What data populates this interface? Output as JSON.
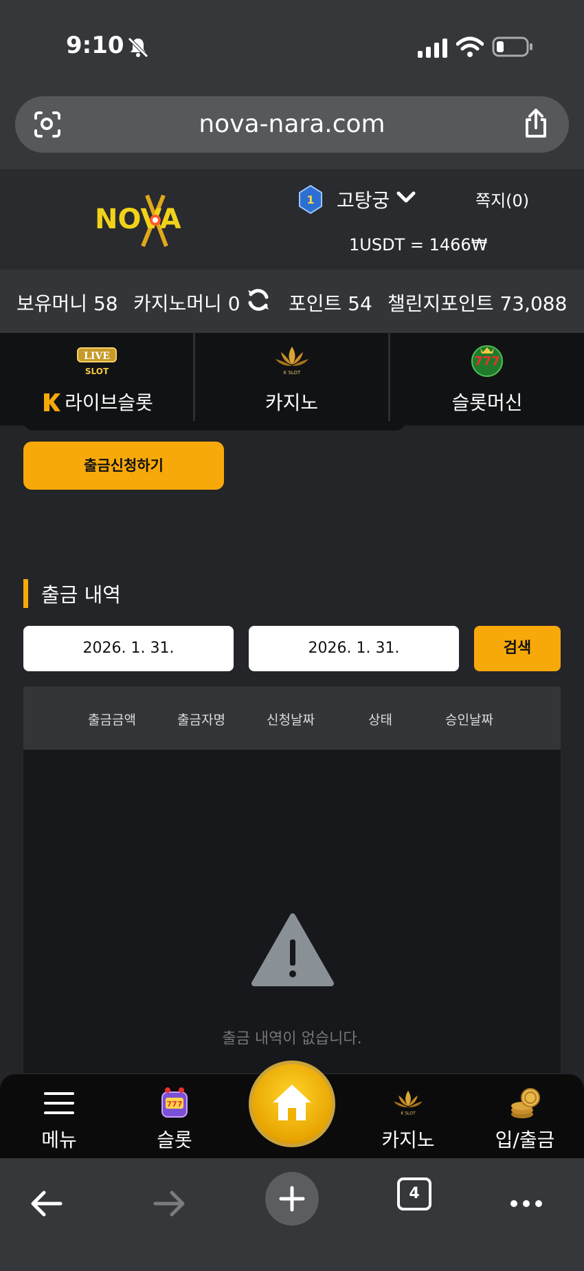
{
  "status": {
    "time": "9:10"
  },
  "browser": {
    "url": "nova-nara.com",
    "tab_count": "4"
  },
  "header": {
    "logo_text": "NOVA",
    "username": "고탕궁",
    "rank": "1",
    "messages": "쪽지(0)",
    "rate": "1USDT = 1466₩"
  },
  "balance": {
    "money": "보유머니 58",
    "casino_money": "카지노머니 0",
    "points": "포인트 54",
    "challenge_points": "챌린지포인트 73,088"
  },
  "game_tabs": [
    {
      "label": "라이브슬롯",
      "icon": "live-slot-icon"
    },
    {
      "label": "카지노",
      "icon": "kslot-icon"
    },
    {
      "label": "슬롯머신",
      "icon": "slot-777-icon"
    }
  ],
  "withdraw_button": "출금신청하기",
  "history": {
    "title": "출금 내역",
    "date_from": "2026. 1. 31.",
    "date_to": "2026. 1. 31.",
    "search_label": "검색",
    "columns": [
      "출금금액",
      "출금자명",
      "신청날짜",
      "상태",
      "승인날짜"
    ],
    "empty_text": "출금 내역이 없습니다."
  },
  "bottom_nav": [
    {
      "label": "메뉴",
      "icon": "hamburger-icon"
    },
    {
      "label": "슬롯",
      "icon": "slot-machine-icon"
    },
    {
      "label": "카지노",
      "icon": "kslot-icon"
    },
    {
      "label": "입/출금",
      "icon": "coins-icon"
    }
  ],
  "colors": {
    "accent": "#f7a90a",
    "background": "#242528"
  }
}
